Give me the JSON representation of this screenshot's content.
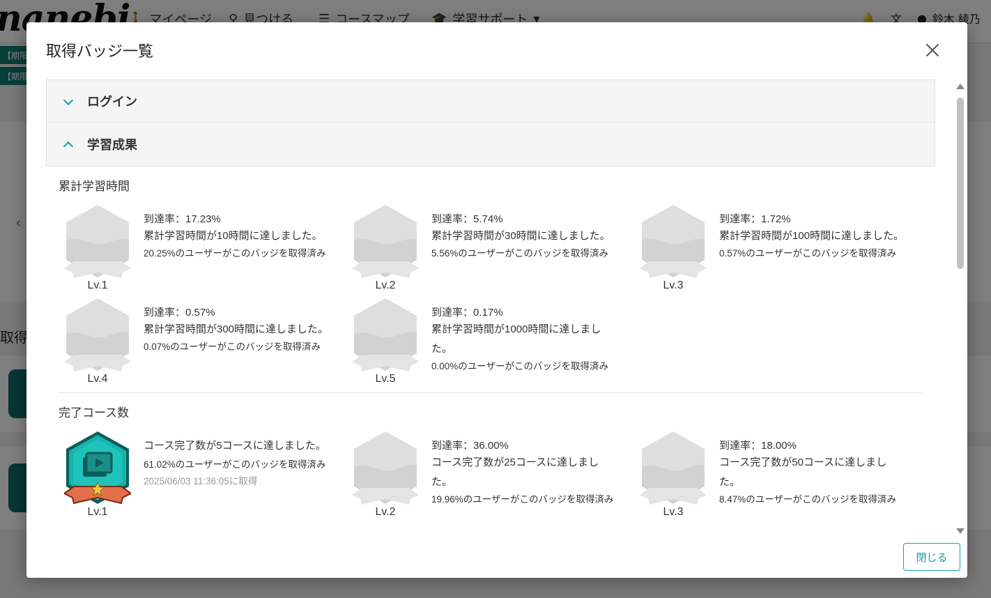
{
  "background": {
    "logo": "nanebi",
    "nav": [
      {
        "icon": "person-icon",
        "label": "マイページ"
      },
      {
        "icon": "search-icon",
        "label": "見つける"
      },
      {
        "icon": "list-icon",
        "label": "コースマップ"
      },
      {
        "icon": "graduation-cap-icon",
        "label": "学習サポート"
      }
    ],
    "user_name": "鈴木 綾乃",
    "banners": [
      "【期限",
      "【期限"
    ],
    "side_title": "取得"
  },
  "modal": {
    "title": "取得バッジ一覧",
    "close_button": "閉じる",
    "accordions": [
      {
        "label": "ログイン",
        "expanded": false
      },
      {
        "label": "学習成果",
        "expanded": true
      }
    ],
    "sections": [
      {
        "title": "累計学習時間",
        "badges": [
          {
            "level": "Lv.1",
            "acquired": false,
            "rate": "到達率：17.23%",
            "desc": "累計学習時間が10時間に達しました。",
            "users": "20.25%のユーザーがこのバッジを取得済み"
          },
          {
            "level": "Lv.2",
            "acquired": false,
            "rate": "到達率：5.74%",
            "desc": "累計学習時間が30時間に達しました。",
            "users": "5.56%のユーザーがこのバッジを取得済み"
          },
          {
            "level": "Lv.3",
            "acquired": false,
            "rate": "到達率：1.72%",
            "desc": "累計学習時間が100時間に達しました。",
            "users": "0.57%のユーザーがこのバッジを取得済み"
          },
          {
            "level": "Lv.4",
            "acquired": false,
            "rate": "到達率：0.57%",
            "desc": "累計学習時間が300時間に達しました。",
            "users": "0.07%のユーザーがこのバッジを取得済み"
          },
          {
            "level": "Lv.5",
            "acquired": false,
            "rate": "到達率：0.17%",
            "desc": "累計学習時間が1000時間に達しました。",
            "users": "0.00%のユーザーがこのバッジを取得済み"
          }
        ]
      },
      {
        "title": "完了コース数",
        "badges": [
          {
            "level": "Lv.1",
            "acquired": true,
            "rate": "",
            "desc": "コース完了数が5コースに達しました。",
            "users": "61.02%のユーザーがこのバッジを取得済み",
            "date": "2025/06/03 11:36:05に取得"
          },
          {
            "level": "Lv.2",
            "acquired": false,
            "rate": "到達率：36.00%",
            "desc": "コース完了数が25コースに達しました。",
            "users": "19.96%のユーザーがこのバッジを取得済み"
          },
          {
            "level": "Lv.3",
            "acquired": false,
            "rate": "到達率：18.00%",
            "desc": "コース完了数が50コースに達しました。",
            "users": "8.47%のユーザーがこのバッジを取得済み"
          }
        ]
      }
    ]
  },
  "colors": {
    "accent": "#14a0a0",
    "badge_locked": "#dcdcdc",
    "badge_teal": "#17b3ad",
    "ribbon": "#e06f4a"
  }
}
